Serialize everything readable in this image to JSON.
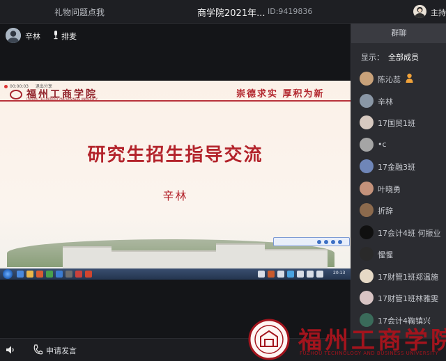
{
  "topbar": {
    "left_link": "礼物问题点我",
    "title": "商学院2021年...",
    "meeting_id": "ID:9419836",
    "host_label": "主持"
  },
  "speaker": {
    "name": "辛林",
    "queue_label": "排麦"
  },
  "shared_screen": {
    "rec_time": "00:00:03",
    "rec_exit": "退出分享",
    "logo_text": "福州工商学院",
    "logo_en": "FUZHOU TECHNOLOGY AND BUSINESS UNIVERSITY",
    "motto": "崇德求实  厚积为新",
    "slide_title": "研究生招生指导交流",
    "slide_speaker": "辛林",
    "clock": "20:13"
  },
  "panel": {
    "tab_label": "群聊",
    "filter_label": "显示：",
    "filter_value": "全部成员",
    "members": [
      {
        "name": "陈沁蕊",
        "color": "#c9a27a"
      },
      {
        "name": "辛林",
        "color": "#8a97a6"
      },
      {
        "name": "17国贸1班",
        "color": "#d7c9c0"
      },
      {
        "name": "•c",
        "color": "#a5a5a5"
      },
      {
        "name": "17金融3班",
        "color": "#6f86b8"
      },
      {
        "name": "叶晓勇",
        "color": "#c4927b"
      },
      {
        "name": "折辞",
        "color": "#8c6a4d"
      },
      {
        "name": "17会计4班  何振业",
        "color": "#101010"
      },
      {
        "name": "惺惺",
        "color": "#2a2a2a"
      },
      {
        "name": "17财管1班郑温施",
        "color": "#e6d9c6"
      },
      {
        "name": "17财管1班林雅雯",
        "color": "#d8c4c4"
      },
      {
        "name": "17会计4鞠镇兴",
        "color": "#3a6b5a"
      }
    ]
  },
  "bottombar": {
    "apply_label": "申请发言"
  },
  "watermark": {
    "text": "福州工商学院",
    "en": "FUZHOU TECHNOLOGY AND BUSINESS UNIVERSITY"
  },
  "colors": {
    "brand_red": "#a3141d",
    "slide_red": "#b3232b"
  }
}
